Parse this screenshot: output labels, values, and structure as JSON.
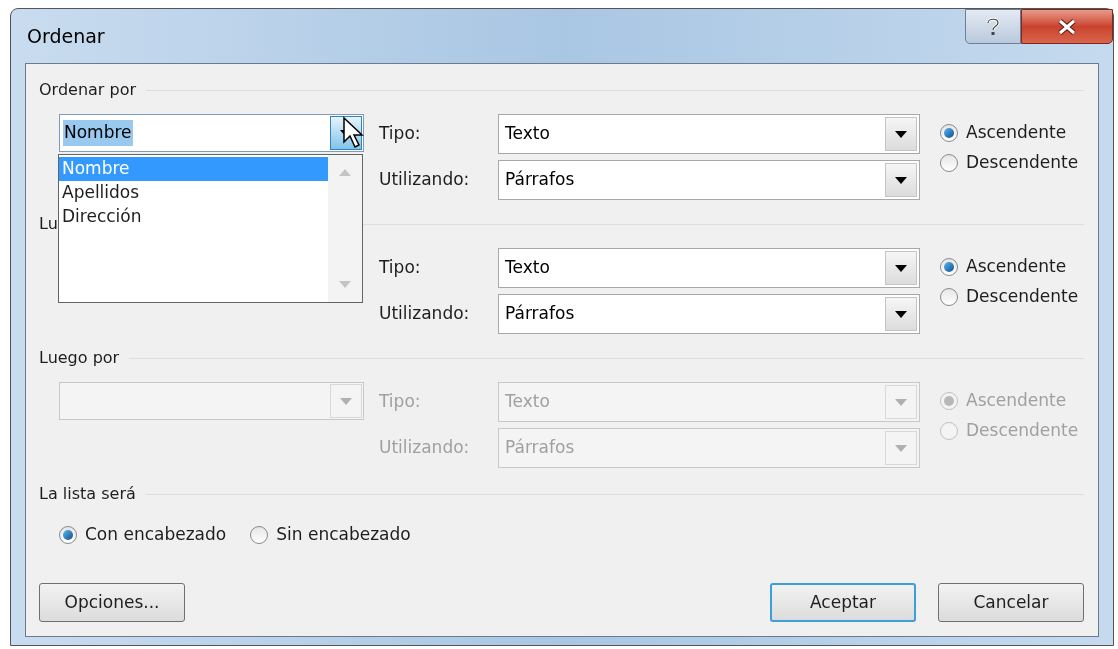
{
  "window": {
    "title": "Ordenar"
  },
  "sort_levels": [
    {
      "label": "Ordenar por",
      "disabled": false,
      "field": {
        "value": "Nombre",
        "text_selected": true
      },
      "type_label": "Tipo:",
      "type": "Texto",
      "using_label": "Utilizando:",
      "using": "Párrafos",
      "order": [
        {
          "label": "Ascendente",
          "selected": true
        },
        {
          "label": "Descendente",
          "selected": false
        }
      ]
    },
    {
      "label": "Lu",
      "disabled": false,
      "type_label": "Tipo:",
      "type": "Texto",
      "using_label": "Utilizando:",
      "using": "Párrafos",
      "order": [
        {
          "label": "Ascendente",
          "selected": true
        },
        {
          "label": "Descendente",
          "selected": false
        }
      ]
    },
    {
      "label": "Luego por",
      "disabled": true,
      "field": {
        "text_selected": false
      },
      "type_label": "Tipo:",
      "type": "Texto",
      "using_label": "Utilizando:",
      "using": "Párrafos",
      "order": [
        {
          "label": "Ascendente",
          "selected": true
        },
        {
          "label": "Descendente",
          "selected": false
        }
      ]
    }
  ],
  "dropdown_list": {
    "items": [
      {
        "label": "Nombre",
        "selected": true
      },
      {
        "label": "Apellidos",
        "selected": false
      },
      {
        "label": "Dirección",
        "selected": false
      }
    ]
  },
  "header_row": {
    "label": "La lista será",
    "options": [
      {
        "label": "Con encabezado",
        "selected": true
      },
      {
        "label": "Sin encabezado",
        "selected": false
      }
    ]
  },
  "buttons": [
    {
      "label": "Opciones...",
      "default": false
    },
    {
      "label": "Aceptar",
      "default": true
    },
    {
      "label": "Cancelar",
      "default": false
    }
  ]
}
